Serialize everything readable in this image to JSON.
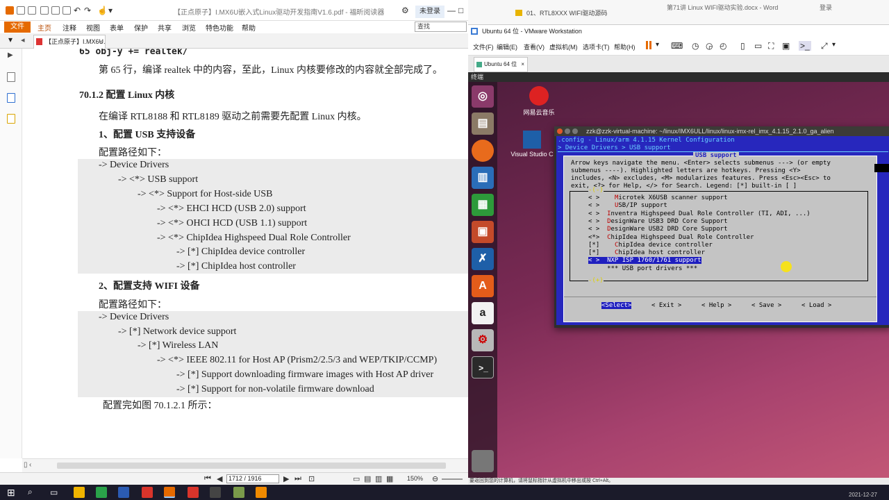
{
  "pdf_window": {
    "title": "【正点原子】I.MX6U嵌入式Linux驱动开发指南V1.6.pdf - 福昕阅读器",
    "login_button": "未登录",
    "file_button": "文件",
    "menu": [
      "主页",
      "注释",
      "视图",
      "表单",
      "保护",
      "共享",
      "浏览",
      "特色功能",
      "帮助"
    ],
    "search_placeholder": "查找",
    "tab_label": "【正点原子】I.MX6U...",
    "page_box": "1712 / 1916",
    "zoom": "150%"
  },
  "document": {
    "code_top": "65 obj-y += realtek/",
    "para1": "第 65 行，编译 realtek 中的内容，至此，Linux 内核要修改的内容就全部完成了。",
    "section": "70.1.2  配置 Linux 内核",
    "para2": "在编译 RTL8188 和 RTL8189 驱动之前需要先配置 Linux 内核。",
    "sub1": "1、配置 USB 支持设备",
    "path_label1": "配置路径如下：",
    "usb_lines": [
      "-> Device Drivers",
      "-> <*> USB support",
      "-> <*> Support for Host-side USB",
      "-> <*> EHCI HCD (USB 2.0) support",
      "-> <*> OHCI HCD (USB 1.1) support",
      "-> <*> ChipIdea Highspeed Dual Role Controller",
      "-> [*] ChipIdea device controller",
      "-> [*] ChipIdea host controller"
    ],
    "sub2": "2、配置支持 WIFI 设备",
    "path_label2": "配置路径如下：",
    "wifi_lines": [
      "-> Device Drivers",
      "-> [*] Network device support",
      "-> [*] Wireless LAN",
      "-> <*> IEEE 802.11 for Host AP (Prism2/2.5/3 and WEP/TKIP/CCMP)",
      "-> [*] Support downloading firmware images with Host AP driver",
      "-> [*] Support for non-volatile firmware download"
    ],
    "footer": "配置完如图 70.1.2.1 所示："
  },
  "right_top": {
    "folder_path": "01、RTL8XXX WIFI驱动源码",
    "word_title": "第71讲 Linux WIFI驱动实验.docx - Word",
    "word_search": "登录"
  },
  "vmware": {
    "title": "Ubuntu 64 位 - VMware Workstation",
    "menu": [
      "文件(F)",
      "编辑(E)",
      "查看(V)",
      "虚拟机(M)",
      "选项卡(T)",
      "帮助(H)"
    ],
    "tab": "Ubuntu 64 位",
    "guest_topbar": "终端",
    "status_hint": "要返回到您的计算机，请将鼠标指针从虚拟机中移出或按 Ctrl+Alt。"
  },
  "desktop": {
    "icons": [
      "网易云音乐",
      "Visual Studio C"
    ]
  },
  "terminal": {
    "title": "zzk@zzk-virtual-machine: ~/linux/IMX6ULL/linux/linux-imx-rel_imx_4.1.15_2.1.0_ga_alien",
    "config_line": ".config - Linux/arm 4.1.15 Kernel Configuration",
    "breadcrumb": "> Device Drivers > USB support",
    "dialog_title": "USB support",
    "help_lines": [
      "Arrow keys navigate the menu.  <Enter> selects submenus ---> (or empty",
      "submenus ----).  Highlighted letters are hotkeys.  Pressing <Y>",
      "includes, <N> excludes, <M> modularizes features.  Press <Esc><Esc> to",
      "exit, <?> for Help, </> for Search.  Legend: [*] built-in  [ ]"
    ],
    "scroll_up": "-(-)",
    "scroll_down": "-(+)",
    "options": [
      {
        "mark": "< >",
        "hotkey": "M",
        "rest": "icrotek X6USB scanner support",
        "indent": 3
      },
      {
        "mark": "< >",
        "hotkey": "U",
        "rest": "SB/IP support",
        "indent": 3
      },
      {
        "mark": "< >",
        "hotkey": "I",
        "rest": "nventra Highspeed Dual Role Controller (TI, ADI, ...)",
        "indent": 1
      },
      {
        "mark": "< >",
        "hotkey": "D",
        "rest": "esignWare USB3 DRD Core Support",
        "indent": 1
      },
      {
        "mark": "< >",
        "hotkey": "D",
        "rest": "esignWare USB2 DRD Core Support",
        "indent": 1
      },
      {
        "mark": "<*>",
        "hotkey": "C",
        "rest": "hipIdea Highspeed Dual Role Controller",
        "indent": 1
      },
      {
        "mark": "[*]",
        "hotkey": "C",
        "rest": "hipIdea device controller",
        "indent": 3
      },
      {
        "mark": "[*]",
        "hotkey": "C",
        "rest": "hipIdea host controller",
        "indent": 3
      },
      {
        "mark": "< >",
        "hotkey": "",
        "rest": "NXP ISP 1760/1761 support",
        "indent": 1,
        "selected": true
      },
      {
        "mark": "",
        "hotkey": "",
        "rest": "*** USB port drivers ***",
        "indent": 1
      }
    ],
    "buttons": [
      "<Select>",
      "< Exit >",
      "< Help >",
      "< Save >",
      "< Load >"
    ]
  },
  "taskbar": {
    "clock_date": "2021-12-27"
  }
}
